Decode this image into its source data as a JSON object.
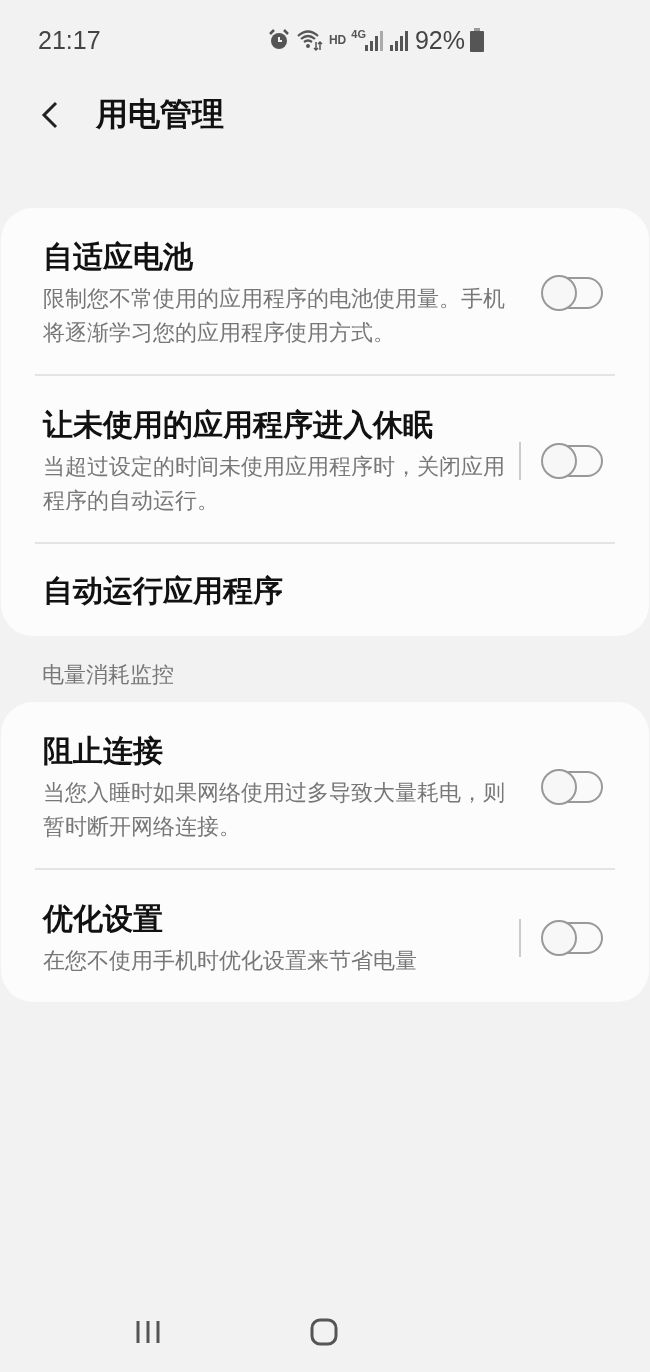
{
  "status_bar": {
    "time": "21:17",
    "hd_label": "HD",
    "network_type": "4G",
    "battery": "92%"
  },
  "header": {
    "title": "用电管理"
  },
  "groups": [
    {
      "items": [
        {
          "kind": "toggle",
          "title": "自适应电池",
          "subtitle": "限制您不常使用的应用程序的电池使用量。手机将逐渐学习您的应用程序使用方式。",
          "on": false,
          "divider": false
        },
        {
          "kind": "toggle",
          "title": "让未使用的应用程序进入休眠",
          "subtitle": "当超过设定的时间未使用应用程序时，关闭应用程序的自动运行。",
          "on": false,
          "divider": true
        },
        {
          "kind": "link",
          "title": "自动运行应用程序"
        }
      ]
    },
    {
      "heading": "电量消耗监控",
      "items": [
        {
          "kind": "toggle",
          "title": "阻止连接",
          "subtitle": "当您入睡时如果网络使用过多导致大量耗电，则暂时断开网络连接。",
          "on": false,
          "divider": false
        },
        {
          "kind": "toggle",
          "title": "优化设置",
          "subtitle": "在您不使用手机时优化设置来节省电量",
          "on": false,
          "divider": true
        }
      ]
    }
  ]
}
